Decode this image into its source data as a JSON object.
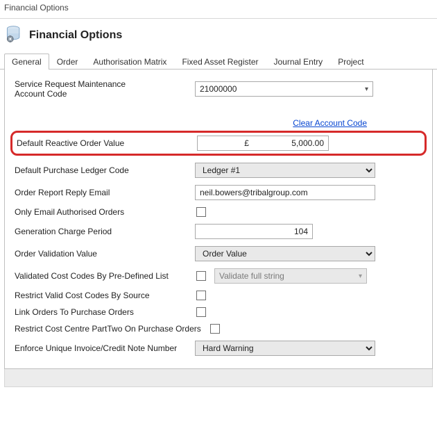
{
  "window_title": "Financial Options",
  "header_title": "Financial Options",
  "tabs": [
    {
      "label": "General",
      "active": true
    },
    {
      "label": "Order"
    },
    {
      "label": "Authorisation Matrix"
    },
    {
      "label": "Fixed Asset Register"
    },
    {
      "label": "Journal Entry"
    },
    {
      "label": "Project"
    }
  ],
  "general": {
    "service_request_label_l1": "Service Request Maintenance",
    "service_request_label_l2": "Account Code",
    "service_request_value": "21000000",
    "clear_account_code": "Clear Account Code",
    "default_reactive_label": "Default Reactive Order Value",
    "default_reactive_currency": "£",
    "default_reactive_value": "5,000.00",
    "default_pl_code_label": "Default Purchase Ledger Code",
    "default_pl_code_value": "Ledger #1",
    "order_reply_email_label": "Order Report Reply Email",
    "order_reply_email_value": "neil.bowers@tribalgroup.com",
    "only_email_auth_label": "Only Email Authorised Orders",
    "generation_charge_label": "Generation Charge Period",
    "generation_charge_value": "104",
    "order_validation_label": "Order Validation Value",
    "order_validation_value": "Order Value",
    "validated_codes_label": "Validated Cost Codes By Pre-Defined List",
    "validate_full_string": "Validate full string",
    "restrict_source_label": "Restrict Valid Cost Codes By Source",
    "link_orders_label": "Link Orders To Purchase Orders",
    "restrict_cc_pt2_label": "Restrict Cost Centre PartTwo On Purchase Orders",
    "enforce_unique_label": "Enforce Unique Invoice/Credit Note Number",
    "enforce_unique_value": "Hard Warning"
  }
}
